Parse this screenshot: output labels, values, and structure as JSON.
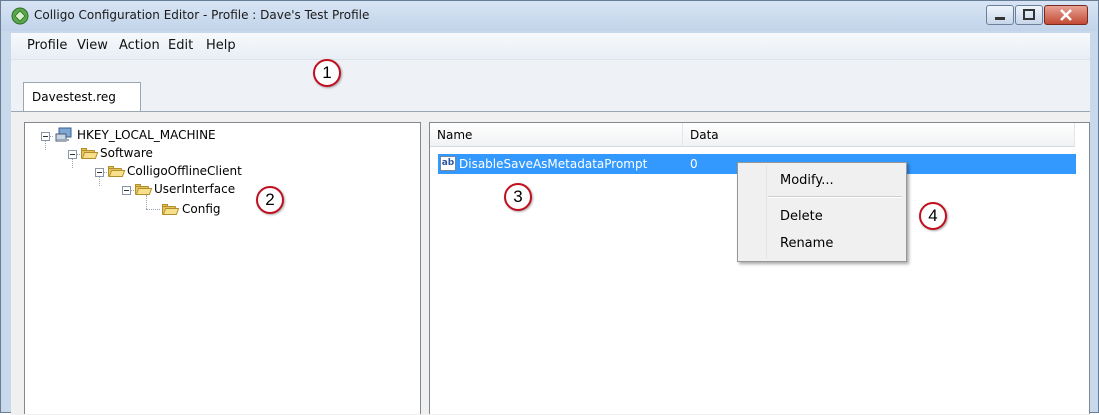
{
  "window": {
    "title": "Colligo Configuration Editor  -  Profile : Dave's Test Profile"
  },
  "menu": {
    "items": [
      "Profile",
      "View",
      "Action",
      "Edit",
      "Help"
    ]
  },
  "tabs": [
    {
      "label": "Davestest.reg"
    }
  ],
  "tree": {
    "nodes": [
      {
        "label": "HKEY_LOCAL_MACHINE",
        "icon": "registry-computer-icon"
      },
      {
        "label": "Software",
        "icon": "folder-open-icon"
      },
      {
        "label": "ColligoOfflineClient",
        "icon": "folder-open-icon"
      },
      {
        "label": "UserInterface",
        "icon": "folder-open-icon"
      },
      {
        "label": "Config",
        "icon": "folder-open-icon"
      }
    ]
  },
  "list": {
    "columns": [
      "Name",
      "Data"
    ],
    "rows": [
      {
        "name": "DisableSaveAsMetadataPrompt",
        "data": "0",
        "icon": "string-value-icon",
        "selected": true
      }
    ],
    "selection_color": "#3399ff"
  },
  "context_menu": {
    "items": [
      "Modify...",
      "Delete",
      "Rename"
    ]
  },
  "callouts": [
    "1",
    "2",
    "3",
    "4"
  ],
  "colors": {
    "callout_border": "#c0101f",
    "close_button": "#c24a35"
  }
}
